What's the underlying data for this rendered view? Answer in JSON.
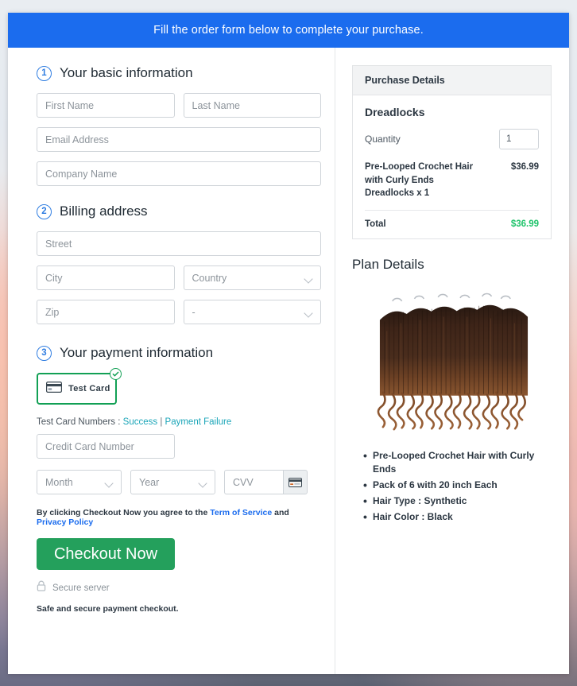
{
  "banner": {
    "text": "Fill the order form below to complete your purchase."
  },
  "steps": {
    "basic": {
      "number": "1",
      "title": "Your basic information"
    },
    "billing": {
      "number": "2",
      "title": "Billing address"
    },
    "payment": {
      "number": "3",
      "title": "Your payment information"
    }
  },
  "fields": {
    "first_name": "First Name",
    "last_name": "Last Name",
    "email": "Email Address",
    "company": "Company Name",
    "street": "Street",
    "city": "City",
    "country": "Country",
    "zip": "Zip",
    "state": "-",
    "credit_card": "Credit Card Number",
    "month": "Month",
    "year": "Year",
    "cvv": "CVV"
  },
  "payment": {
    "test_card_label": "Test Card",
    "test_numbers_label": "Test Card Numbers :",
    "success_link": "Success",
    "separator": "|",
    "failure_link": "Payment Failure"
  },
  "terms": {
    "prefix": "By clicking Checkout Now you agree to the",
    "tos_link": "Term of Service",
    "conjunction": "and",
    "privacy_link": "Privacy Policy"
  },
  "actions": {
    "checkout_label": "Checkout Now",
    "secure_server": "Secure server",
    "safe_note": "Safe and secure payment checkout."
  },
  "purchase_details": {
    "heading": "Purchase Details",
    "product_name": "Dreadlocks",
    "quantity_label": "Quantity",
    "quantity_value": "1",
    "line_item_desc": "Pre-Looped Crochet Hair with Curly Ends Dreadlocks x 1",
    "line_item_price": "$36.99",
    "total_label": "Total",
    "total_value": "$36.99"
  },
  "plan_details": {
    "heading": "Plan Details",
    "image_alt": "dreadlocks-product-photo",
    "bullets": [
      "Pre-Looped Crochet Hair with Curly Ends",
      "Pack of 6 with 20 inch Each",
      "Hair Type : Synthetic",
      "Hair Color : Black"
    ]
  },
  "colors": {
    "banner_blue": "#1b6cee",
    "step_blue": "#2f7de1",
    "checkout_green": "#24a05c",
    "selected_border_green": "#12a055",
    "total_green": "#1ec36a",
    "test_link_teal": "#1aa5b8",
    "terms_link_blue": "#1b6cee"
  }
}
